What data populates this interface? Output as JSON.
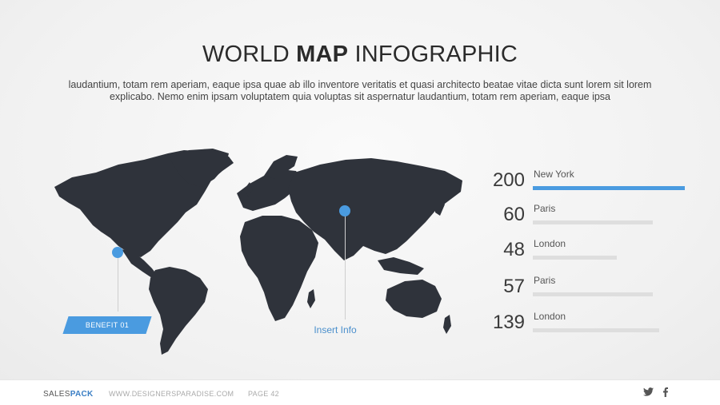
{
  "title": {
    "part1": "WORLD ",
    "bold": "MAP",
    "part2": " INFOGRAPHIC"
  },
  "subtitle": "laudantium, totam rem aperiam, eaque ipsa quae ab illo inventore veritatis et quasi architecto beatae vitae dicta sunt lorem sit lorem explicabo. Nemo enim ipsam voluptatem quia voluptas sit aspernatur laudantium, totam rem aperiam, eaque ipsa",
  "map": {
    "callout_left": "BENEFIT 01",
    "callout_right": "Insert Info"
  },
  "stats": [
    {
      "value": "200",
      "label": "New York",
      "fill": 1.0,
      "highlight": true
    },
    {
      "value": "60",
      "label": "Paris",
      "fill": 0.79,
      "highlight": false
    },
    {
      "value": "48",
      "label": "London",
      "fill": 0.55,
      "highlight": false
    },
    {
      "value": "57",
      "label": "Paris",
      "fill": 0.79,
      "highlight": false
    },
    {
      "value": "139",
      "label": "London",
      "fill": 0.83,
      "highlight": false
    }
  ],
  "footer": {
    "brand_regular": "SALES",
    "brand_bold": "PACK",
    "website": "WWW.DESIGNERSPARADISE.COM",
    "page": "PAGE 42"
  },
  "icons": [
    "twitter-icon",
    "facebook-icon"
  ],
  "colors": {
    "accent": "#4a9be0",
    "map": "#2f333b",
    "track": "#dedede"
  }
}
